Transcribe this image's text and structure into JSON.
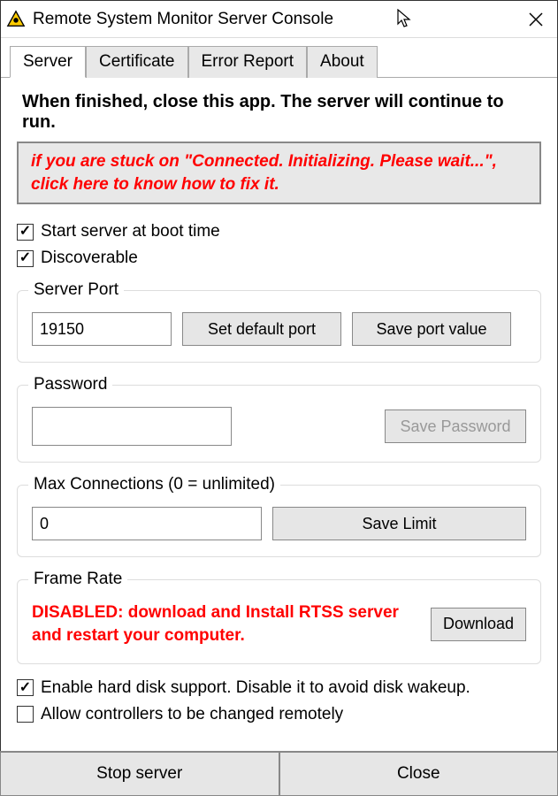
{
  "window": {
    "title": "Remote System Monitor Server Console"
  },
  "tabs": {
    "server": "Server",
    "certificate": "Certificate",
    "errorReport": "Error Report",
    "about": "About"
  },
  "heading": "When finished, close this app. The server will continue to run.",
  "warning": "if you are stuck on \"Connected. Initializing. Please wait...\", click here to know how to fix it.",
  "checkboxes": {
    "startAtBoot": "Start server at boot time",
    "discoverable": "Discoverable",
    "hardDisk": "Enable hard disk support. Disable it to avoid disk wakeup.",
    "controllers": "Allow controllers to be changed remotely"
  },
  "serverPort": {
    "legend": "Server Port",
    "value": "19150",
    "setDefault": "Set default port",
    "save": "Save port value"
  },
  "password": {
    "legend": "Password",
    "value": "",
    "save": "Save Password"
  },
  "maxConnections": {
    "legend": "Max Connections (0 = unlimited)",
    "value": "0",
    "save": "Save Limit"
  },
  "frameRate": {
    "legend": "Frame Rate",
    "text": "DISABLED: download and Install RTSS server and restart your computer.",
    "download": "Download"
  },
  "bottom": {
    "stop": "Stop server",
    "close": "Close"
  }
}
